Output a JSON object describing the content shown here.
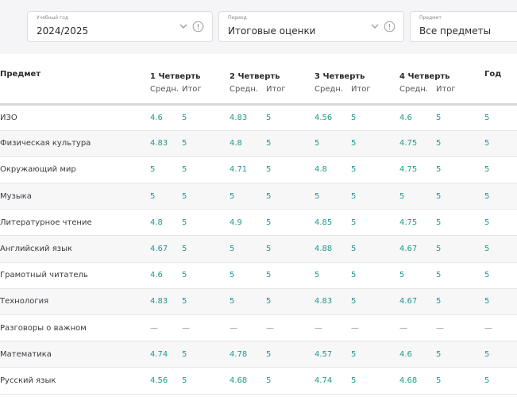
{
  "filters": {
    "year": {
      "caption": "Учебный год",
      "value": "2024/2025"
    },
    "period": {
      "caption": "Период",
      "value": "Итоговые оценки"
    },
    "subject": {
      "caption": "Предмет",
      "value": "Все предметы"
    },
    "icons": {
      "chevron": "chevron-down-icon",
      "info": "info-icon"
    }
  },
  "table": {
    "subject_header": "Предмет",
    "year_header": "Год",
    "quarters": [
      {
        "label": "1 Четверть",
        "avg_label": "Средн.",
        "final_label": "Итог"
      },
      {
        "label": "2 Четверть",
        "avg_label": "Средн.",
        "final_label": "Итог"
      },
      {
        "label": "3 Четверть",
        "avg_label": "Средн.",
        "final_label": "Итог"
      },
      {
        "label": "4 Четверть",
        "avg_label": "Средн.",
        "final_label": "Итог"
      }
    ],
    "rows": [
      {
        "subject": "ИЗО",
        "q": [
          [
            "4.6",
            "5"
          ],
          [
            "4.83",
            "5"
          ],
          [
            "4.56",
            "5"
          ],
          [
            "4.6",
            "5"
          ]
        ],
        "year": "5"
      },
      {
        "subject": "Физическая культура",
        "q": [
          [
            "4.83",
            "5"
          ],
          [
            "4.8",
            "5"
          ],
          [
            "5",
            "5"
          ],
          [
            "4.75",
            "5"
          ]
        ],
        "year": "5"
      },
      {
        "subject": "Окружающий мир",
        "q": [
          [
            "5",
            "5"
          ],
          [
            "4.71",
            "5"
          ],
          [
            "4.8",
            "5"
          ],
          [
            "4.75",
            "5"
          ]
        ],
        "year": "5"
      },
      {
        "subject": "Музыка",
        "q": [
          [
            "5",
            "5"
          ],
          [
            "5",
            "5"
          ],
          [
            "5",
            "5"
          ],
          [
            "5",
            "5"
          ]
        ],
        "year": "5"
      },
      {
        "subject": "Литературное чтение",
        "q": [
          [
            "4.8",
            "5"
          ],
          [
            "4.9",
            "5"
          ],
          [
            "4.85",
            "5"
          ],
          [
            "4.75",
            "5"
          ]
        ],
        "year": "5"
      },
      {
        "subject": "Английский язык",
        "q": [
          [
            "4.67",
            "5"
          ],
          [
            "5",
            "5"
          ],
          [
            "4.88",
            "5"
          ],
          [
            "4.67",
            "5"
          ]
        ],
        "year": "5"
      },
      {
        "subject": "Грамотный читатель",
        "q": [
          [
            "4.6",
            "5"
          ],
          [
            "5",
            "5"
          ],
          [
            "5",
            "5"
          ],
          [
            "5",
            "5"
          ]
        ],
        "year": "5"
      },
      {
        "subject": "Технология",
        "q": [
          [
            "4.83",
            "5"
          ],
          [
            "5",
            "5"
          ],
          [
            "4.83",
            "5"
          ],
          [
            "4.67",
            "5"
          ]
        ],
        "year": "5"
      },
      {
        "subject": "Разговоры о важном",
        "q": [
          [
            "—",
            "—"
          ],
          [
            "—",
            "—"
          ],
          [
            "—",
            "—"
          ],
          [
            "—",
            "—"
          ]
        ],
        "year": "—"
      },
      {
        "subject": "Математика",
        "q": [
          [
            "4.74",
            "5"
          ],
          [
            "4.78",
            "5"
          ],
          [
            "4.57",
            "5"
          ],
          [
            "4.6",
            "5"
          ]
        ],
        "year": "5"
      },
      {
        "subject": "Русский язык",
        "q": [
          [
            "4.56",
            "5"
          ],
          [
            "4.68",
            "5"
          ],
          [
            "4.74",
            "5"
          ],
          [
            "4.68",
            "5"
          ]
        ],
        "year": "5"
      }
    ]
  },
  "colors": {
    "grade": "#1f9a8a",
    "header_text": "#2b2b2b",
    "filter_bar_bg": "#f5f5f7"
  }
}
